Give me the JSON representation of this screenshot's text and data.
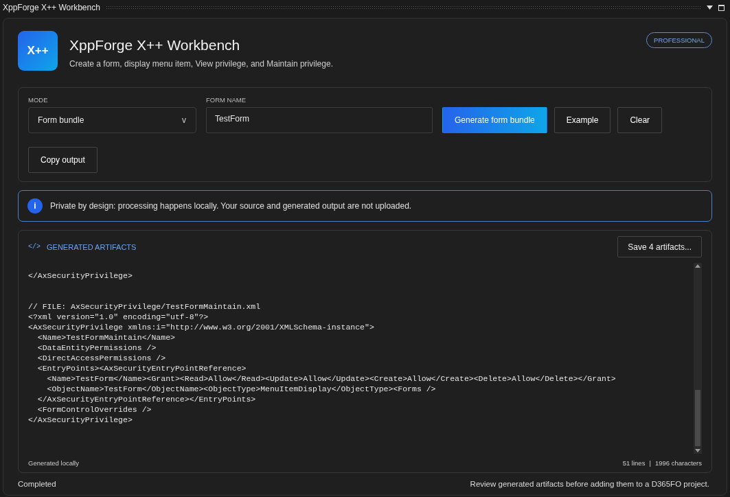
{
  "window": {
    "title": "XppForge X++ Workbench"
  },
  "header": {
    "logo": "X++",
    "title": "XppForge X++ Workbench",
    "subtitle": "Create a form, display menu item, View privilege, and Maintain privilege.",
    "badge": "PROFESSIONAL"
  },
  "form": {
    "mode": {
      "label": "MODE",
      "value": "Form bundle",
      "caret": "v"
    },
    "form_name": {
      "label": "FORM NAME",
      "value": "TestForm"
    },
    "buttons": [
      {
        "label": "Generate form bundle",
        "kind": "primary"
      },
      {
        "label": "Example",
        "kind": "secondary"
      },
      {
        "label": "Clear",
        "kind": "secondary"
      },
      {
        "label": "Copy output",
        "kind": "secondary"
      }
    ]
  },
  "notice": {
    "icon": "i",
    "text": "Private by design: processing happens locally. Your source and generated output are not uploaded."
  },
  "artifacts": {
    "icon": "</>",
    "title": "GENERATED ARTIFACTS",
    "save_button": "Save 4 artifacts...",
    "code_blocks": [
      [
        "</AxSecurityPrivilege>"
      ],
      [
        "// FILE: AxSecurityPrivilege/TestFormMaintain.xml",
        "<?xml version=\"1.0\" encoding=\"utf-8\"?>",
        "<AxSecurityPrivilege xmlns:i=\"http://www.w3.org/2001/XMLSchema-instance\">",
        "  <Name>TestFormMaintain</Name>",
        "  <DataEntityPermissions />",
        "  <DirectAccessPermissions />",
        "  <EntryPoints><AxSecurityEntryPointReference>",
        "    <Name>TestForm</Name><Grant><Read>Allow</Read><Update>Allow</Update><Create>Allow</Create><Delete>Allow</Delete></Grant>",
        "    <ObjectName>TestForm</ObjectName><ObjectType>MenuItemDisplay</ObjectType><Forms />",
        "  </AxSecurityEntryPointReference></EntryPoints>",
        "  <FormControlOverrides />",
        "</AxSecurityPrivilege>"
      ]
    ],
    "footer_left": "Generated locally",
    "footer_right": [
      "51 lines",
      "|",
      "1996 characters"
    ]
  },
  "status_bar": {
    "left": "Completed",
    "right": "Review generated artifacts before adding them to a D365FO project."
  }
}
